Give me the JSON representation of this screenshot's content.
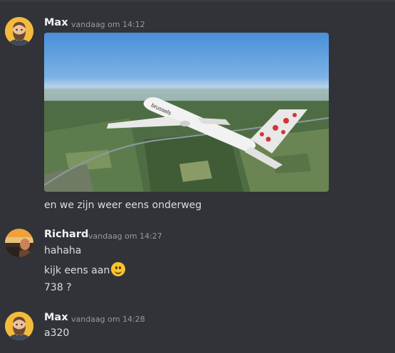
{
  "messages": [
    {
      "author": "Max",
      "timestamp": "vandaag om 14:12",
      "avatar_icon": "bearded-man-avatar",
      "attachment": {
        "type": "image",
        "icon": "airplane-over-landscape-photo",
        "livery_text": "brussels"
      },
      "lines": [
        "en we zijn weer eens onderweg"
      ]
    },
    {
      "author": "Richard",
      "timestamp": "vandaag om 14:27",
      "avatar_icon": "sunset-photo-avatar",
      "lines": [
        "hahaha",
        "kijk eens aan",
        "738 ?"
      ],
      "emoji": "slightly-smiling-face-icon"
    },
    {
      "author": "Max",
      "timestamp": "vandaag om 14:28",
      "avatar_icon": "bearded-man-avatar",
      "lines": [
        "a320"
      ]
    }
  ],
  "colors": {
    "background": "#313338",
    "text": "#dbdee1",
    "muted": "#949ba4",
    "username": "#f2f3f5"
  }
}
